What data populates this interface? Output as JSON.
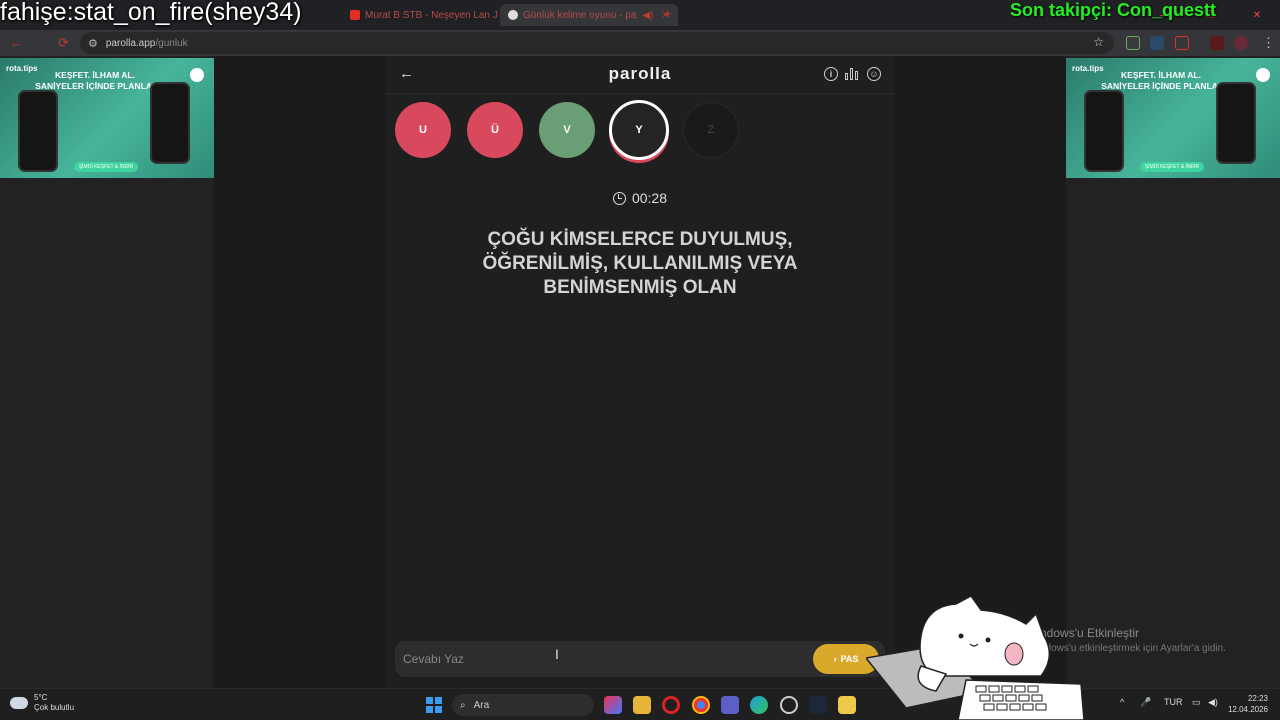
{
  "overlay": {
    "left_text": "fahişe:stat_on_fire(shey34)",
    "right_text": "Son takipçi: Con_questt"
  },
  "browser": {
    "tabs": [
      {
        "label": "Murat B STB - Neşeyen Lan J",
        "favicon_color": "#e52d27"
      },
      {
        "label": "Günlük kelime oyunu - pa",
        "favicon_color": "#dddddd"
      }
    ],
    "url": {
      "host": "parolla.app",
      "path": "/gunluk"
    }
  },
  "ad": {
    "brand": "rota.tips",
    "headline": "KEŞFET. İLHAM AL. SANİYELER İÇİNDE PLANLA!",
    "cta": "ŞİMDİ KEŞFET & İNDİR"
  },
  "app": {
    "title": "parolla",
    "icons": [
      "info-icon",
      "stats-icon",
      "profile-icon"
    ]
  },
  "letters": [
    {
      "char": "U",
      "state": "wrong"
    },
    {
      "char": "Ü",
      "state": "wrong"
    },
    {
      "char": "V",
      "state": "correct"
    },
    {
      "char": "Y",
      "state": "current"
    },
    {
      "char": "Z",
      "state": "pending"
    }
  ],
  "timer": "00:28",
  "question": "ÇOĞU KİMSELERCE DUYULMUŞ, ÖĞRENİLMİŞ, KULLANILMIŞ VEYA BENİMSENMİŞ OLAN",
  "answer": {
    "placeholder": "Cevabı Yaz",
    "value": "",
    "pass_label": "PAS"
  },
  "watermark": {
    "line1": "ndows'u Etkinleştir",
    "line2": "ndows'u etkinleştirmek için Ayarlar'a gidin."
  },
  "taskbar": {
    "weather_temp": "5°C",
    "weather_desc": "Çok bulutlu",
    "search_label": "Ara",
    "language": "TUR",
    "time": "22:23",
    "date": "12.04.2026"
  },
  "colors": {
    "wrong": "#d9495e",
    "correct": "#6a9e74",
    "pass": "#d8a92b",
    "overlay_green": "#22ee22"
  }
}
